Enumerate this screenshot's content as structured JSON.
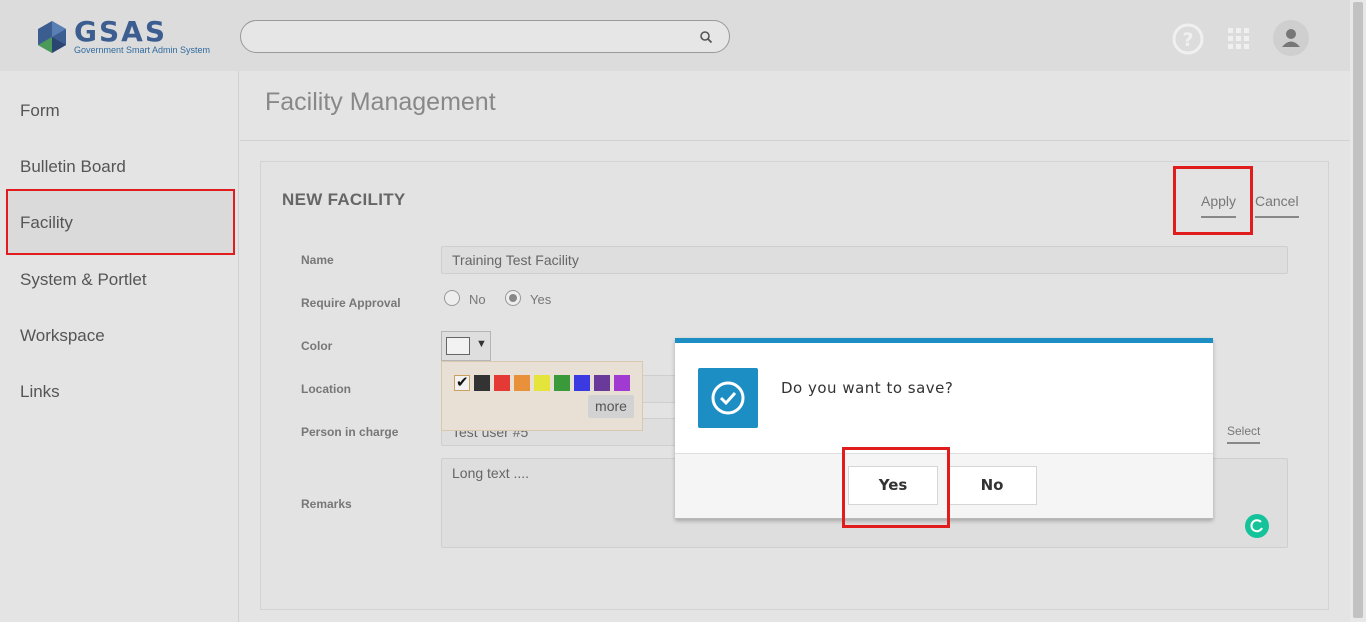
{
  "app": {
    "logo_title": "GSAS",
    "logo_subtitle": "Government Smart Admin System",
    "search_placeholder": ""
  },
  "header": {
    "icons": [
      "help-icon",
      "apps-grid-icon",
      "user-avatar-icon"
    ]
  },
  "sidebar": {
    "items": [
      {
        "label": "Form"
      },
      {
        "label": "Bulletin Board"
      },
      {
        "label": "Facility",
        "highlighted": true
      },
      {
        "label": "System & Portlet"
      },
      {
        "label": "Workspace"
      },
      {
        "label": "Links"
      }
    ]
  },
  "page": {
    "title": "Facility Management"
  },
  "form": {
    "title": "NEW FACILITY",
    "apply_label": "Apply",
    "cancel_label": "Cancel",
    "name_label": "Name",
    "name_value": "Training Test Facility",
    "approval_label": "Require Approval",
    "approval_no": "No",
    "approval_yes": "Yes",
    "approval_selected": "Yes",
    "color_label": "Color",
    "color_caret": "▼",
    "palette_colors": [
      "#f2f2f2",
      "#333333",
      "#e53935",
      "#e8903a",
      "#e4e43a",
      "#3a9a3a",
      "#3a3ae0",
      "#6a3a9a",
      "#a03ad0"
    ],
    "palette_check": "✔",
    "more_label": "more",
    "location_label": "Location",
    "person_label": "Person in charge",
    "person_value": "Test user #5",
    "select_label": "Select",
    "remarks_label": "Remarks",
    "remarks_value": "Long text ...."
  },
  "dialog": {
    "message": "Do you want to save?",
    "yes_label": "Yes",
    "no_label": "No",
    "accent_color": "#1c8ec4"
  },
  "annotations": {
    "highlight_color": "#e01c1c"
  }
}
